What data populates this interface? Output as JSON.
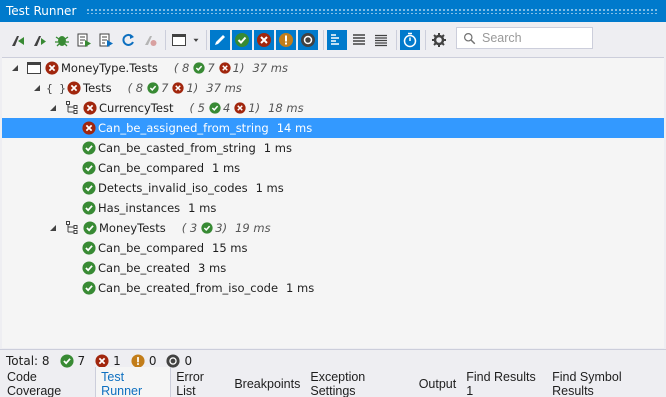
{
  "window": {
    "title": "Test Runner"
  },
  "search": {
    "placeholder": "Search"
  },
  "tree": {
    "root": {
      "label": "MoneyType.Tests",
      "total": "8",
      "passed": "7",
      "failed": "1",
      "duration": "37 ms"
    },
    "namespace": {
      "label": "Tests",
      "total": "8",
      "passed": "7",
      "failed": "1",
      "duration": "37 ms"
    },
    "currency": {
      "label": "CurrencyTest",
      "total": "5",
      "passed": "4",
      "failed": "1",
      "duration": "18 ms"
    },
    "currency_tests": [
      {
        "label": "Can_be_assigned_from_string",
        "duration": "14 ms",
        "status": "failed"
      },
      {
        "label": "Can_be_casted_from_string",
        "duration": "1 ms",
        "status": "passed"
      },
      {
        "label": "Can_be_compared",
        "duration": "1 ms",
        "status": "passed"
      },
      {
        "label": "Detects_invalid_iso_codes",
        "duration": "1 ms",
        "status": "passed"
      },
      {
        "label": "Has_instances",
        "duration": "1 ms",
        "status": "passed"
      }
    ],
    "money": {
      "label": "MoneyTests",
      "total": "3",
      "passed": "3",
      "duration": "19 ms"
    },
    "money_tests": [
      {
        "label": "Can_be_compared",
        "duration": "15 ms",
        "status": "passed"
      },
      {
        "label": "Can_be_created",
        "duration": "3 ms",
        "status": "passed"
      },
      {
        "label": "Can_be_created_from_iso_code",
        "duration": "1 ms",
        "status": "passed"
      }
    ]
  },
  "status": {
    "total_label": "Total: 8",
    "passed": "7",
    "failed": "1",
    "inconclusive": "0",
    "skipped": "0"
  },
  "tabs": [
    {
      "label": "Code Coverage"
    },
    {
      "label": "Test Runner"
    },
    {
      "label": "Error List"
    },
    {
      "label": "Breakpoints"
    },
    {
      "label": "Exception Settings"
    },
    {
      "label": "Output"
    },
    {
      "label": "Find Results 1"
    },
    {
      "label": "Find Symbol Results"
    }
  ],
  "colors": {
    "accent": "#007acc",
    "pass": "#388a34",
    "fail": "#a1260d",
    "warn": "#c27d1a",
    "selection": "#3399ff"
  }
}
